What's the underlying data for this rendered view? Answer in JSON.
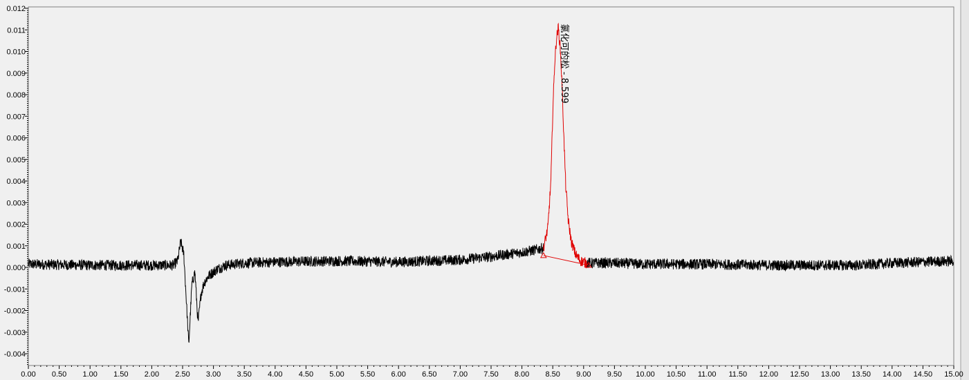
{
  "chart_data": {
    "type": "line",
    "title": "",
    "xlabel": "",
    "ylabel": "",
    "xlim": [
      0.0,
      15.0
    ],
    "ylim": [
      -0.0045,
      0.012
    ],
    "x_ticks": [
      "0.00",
      "0.50",
      "1.00",
      "1.50",
      "2.00",
      "2.50",
      "3.00",
      "3.50",
      "4.00",
      "4.50",
      "5.00",
      "5.50",
      "6.00",
      "6.50",
      "7.00",
      "7.50",
      "8.00",
      "8.50",
      "9.00",
      "9.50",
      "10.00",
      "10.50",
      "11.00",
      "11.50",
      "12.00",
      "12.50",
      "13.00",
      "13.50",
      "14.00",
      "14.50",
      "15.00"
    ],
    "y_ticks": [
      "0.012",
      "0.011",
      "0.010",
      "0.009",
      "0.008",
      "0.007",
      "0.006",
      "0.005",
      "0.004",
      "0.003",
      "0.002",
      "0.001",
      "0.000",
      "-0.001",
      "-0.002",
      "-0.003",
      "-0.004"
    ],
    "grid": false,
    "series": [
      {
        "color": "#000000",
        "x": [
          0.0,
          1.0,
          2.0,
          2.35,
          2.42,
          2.47,
          2.52,
          2.56,
          2.6,
          2.65,
          2.7,
          2.75,
          2.8,
          2.85,
          2.92,
          3.05,
          3.2,
          3.5,
          4.0,
          5.0,
          6.0,
          7.0,
          7.5,
          8.0,
          8.2,
          8.35
        ],
        "y": [
          0.00015,
          0.0001,
          0.0001,
          0.0001,
          0.0003,
          0.0012,
          0.0006,
          -0.0015,
          -0.0036,
          -0.0008,
          -0.0002,
          -0.0026,
          -0.0012,
          -0.0007,
          -0.0004,
          -0.0001,
          0.0001,
          0.0002,
          0.00025,
          0.0003,
          0.00025,
          0.00035,
          0.0005,
          0.0007,
          0.0008,
          0.0009
        ]
      },
      {
        "color": "#e00000",
        "x": [
          8.35,
          8.42,
          8.47,
          8.5,
          8.53,
          8.56,
          8.59,
          8.62,
          8.65,
          8.68,
          8.71,
          8.75,
          8.8,
          8.87,
          8.95,
          9.05
        ],
        "y": [
          0.0009,
          0.0018,
          0.004,
          0.0072,
          0.0094,
          0.0106,
          0.0111,
          0.0102,
          0.0085,
          0.006,
          0.0038,
          0.0022,
          0.0012,
          0.0006,
          0.0003,
          0.0002
        ]
      },
      {
        "color": "#000000",
        "x": [
          9.05,
          9.5,
          10.0,
          11.0,
          12.0,
          13.0,
          13.5,
          14.0,
          14.5,
          15.0
        ],
        "y": [
          0.0002,
          0.0002,
          0.00015,
          0.00015,
          0.0001,
          0.0001,
          0.0001,
          0.0002,
          0.00025,
          0.0003
        ]
      }
    ],
    "baseline": {
      "color": "#e00000",
      "points": [
        [
          8.35,
          0.00055
        ],
        [
          9.08,
          0.0001
        ]
      ]
    },
    "annotations": [
      {
        "text": "氯化可的松 - 8.599",
        "x": 8.599,
        "y": 0.0115
      }
    ]
  }
}
